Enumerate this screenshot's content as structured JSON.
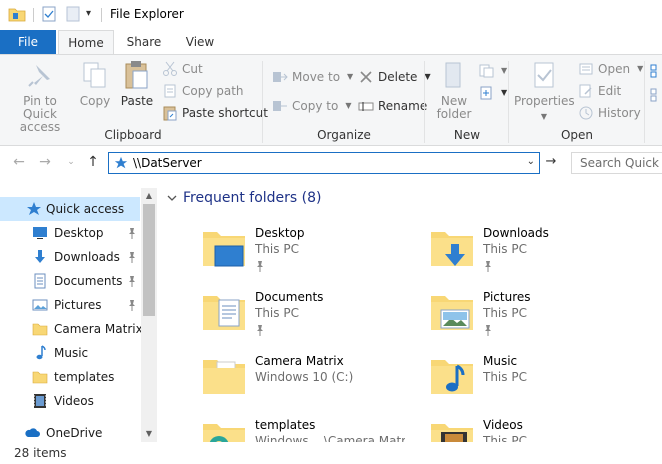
{
  "window": {
    "title": "File Explorer"
  },
  "tabs": {
    "file": "File",
    "home": "Home",
    "share": "Share",
    "view": "View"
  },
  "ribbon": {
    "clipboard": {
      "label": "Clipboard",
      "pin_quick_access": "Pin to Quick access",
      "copy": "Copy",
      "paste": "Paste",
      "cut": "Cut",
      "copy_path": "Copy path",
      "paste_shortcut": "Paste shortcut"
    },
    "organize": {
      "label": "Organize",
      "move_to": "Move to",
      "copy_to": "Copy to",
      "delete": "Delete",
      "rename": "Rename"
    },
    "new": {
      "label": "New",
      "new_folder": "New folder"
    },
    "open": {
      "label": "Open",
      "properties": "Properties",
      "open": "Open",
      "edit": "Edit",
      "history": "History"
    }
  },
  "address": {
    "path": "\\\\DatServer",
    "search_placeholder": "Search Quick access"
  },
  "nav": {
    "items": [
      {
        "label": "Quick access",
        "icon": "star-icon",
        "pinned": false
      },
      {
        "label": "Desktop",
        "icon": "desktop-icon",
        "pinned": true
      },
      {
        "label": "Downloads",
        "icon": "downloads-icon",
        "pinned": true
      },
      {
        "label": "Documents",
        "icon": "documents-icon",
        "pinned": true
      },
      {
        "label": "Pictures",
        "icon": "pictures-icon",
        "pinned": true
      },
      {
        "label": "Camera Matrix",
        "icon": "folder-icon",
        "pinned": false
      },
      {
        "label": "Music",
        "icon": "music-icon",
        "pinned": false
      },
      {
        "label": "templates",
        "icon": "folder-icon",
        "pinned": false
      },
      {
        "label": "Videos",
        "icon": "videos-icon",
        "pinned": false
      },
      {
        "label": "OneDrive",
        "icon": "cloud-icon",
        "pinned": false
      }
    ]
  },
  "content": {
    "section_title": "Frequent folders (8)",
    "folders": [
      {
        "name": "Desktop",
        "location": "This PC",
        "pinned": true,
        "icon": "desktop-folder-icon"
      },
      {
        "name": "Downloads",
        "location": "This PC",
        "pinned": true,
        "icon": "downloads-folder-icon"
      },
      {
        "name": "Documents",
        "location": "This PC",
        "pinned": true,
        "icon": "documents-folder-icon"
      },
      {
        "name": "Pictures",
        "location": "This PC",
        "pinned": true,
        "icon": "pictures-folder-icon"
      },
      {
        "name": "Camera Matrix",
        "location": "Windows 10 (C:)",
        "pinned": false,
        "icon": "folder-icon"
      },
      {
        "name": "Music",
        "location": "This PC",
        "pinned": false,
        "icon": "music-folder-icon"
      },
      {
        "name": "templates",
        "location": "Windows ...\\Camera Matrix",
        "pinned": false,
        "icon": "templates-folder-icon"
      },
      {
        "name": "Videos",
        "location": "This PC",
        "pinned": false,
        "icon": "videos-folder-icon"
      }
    ]
  },
  "status": {
    "item_count": "28 items"
  },
  "colors": {
    "accent": "#1a6fc4",
    "selection": "#cce8ff",
    "folder": "#f8d775",
    "section_title": "#1e3287"
  }
}
